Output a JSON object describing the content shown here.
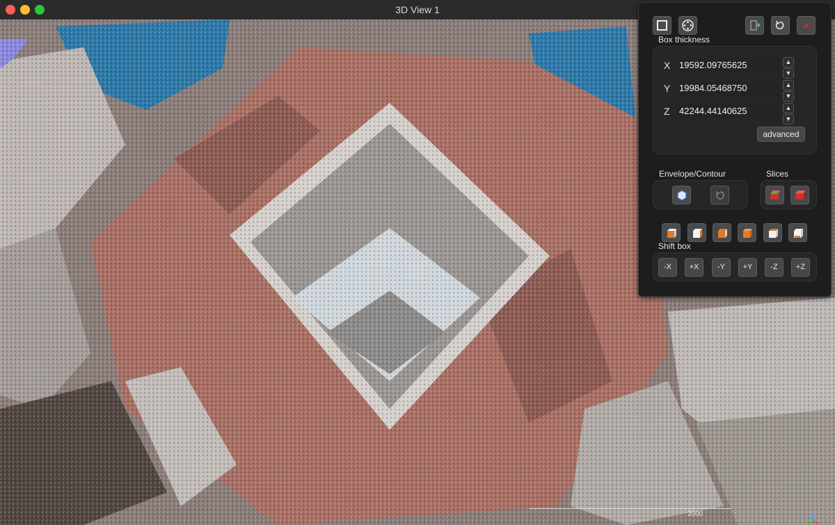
{
  "window": {
    "title": "3D View 1"
  },
  "viewport": {
    "scale_bar_label": "2000",
    "colors": {
      "floor": "#a86e63",
      "walls": "#c9c4c0",
      "sky_blue": "#2c78a8",
      "dark": "#3a302c"
    }
  },
  "panel": {
    "top_icons": [
      "box-select-icon",
      "move-cross-icon",
      "export-icon",
      "reset-icon",
      "close-red-icon"
    ],
    "box_thickness": {
      "label": "Box thickness",
      "x_label": "X",
      "x_value": "19592.09765625",
      "y_label": "Y",
      "y_value": "19984.05468750",
      "z_label": "Z",
      "z_value": "42244.44140625",
      "advanced_label": "advanced"
    },
    "envelope": {
      "label": "Envelope/Contour"
    },
    "slices": {
      "label": "Slices"
    },
    "view_icons": [
      "cube-front-icon",
      "cube-back-icon",
      "cube-left-icon",
      "cube-right-icon",
      "cube-top-icon",
      "cube-bottom-icon"
    ],
    "shift_box": {
      "label": "Shift box",
      "buttons": [
        "-X",
        "+X",
        "-Y",
        "+Y",
        "-Z",
        "+Z"
      ]
    },
    "colors": {
      "background": "#1d1d1d",
      "button": "#474747",
      "accent_red": "#d03030",
      "accent_orange": "#e07a2a"
    }
  }
}
